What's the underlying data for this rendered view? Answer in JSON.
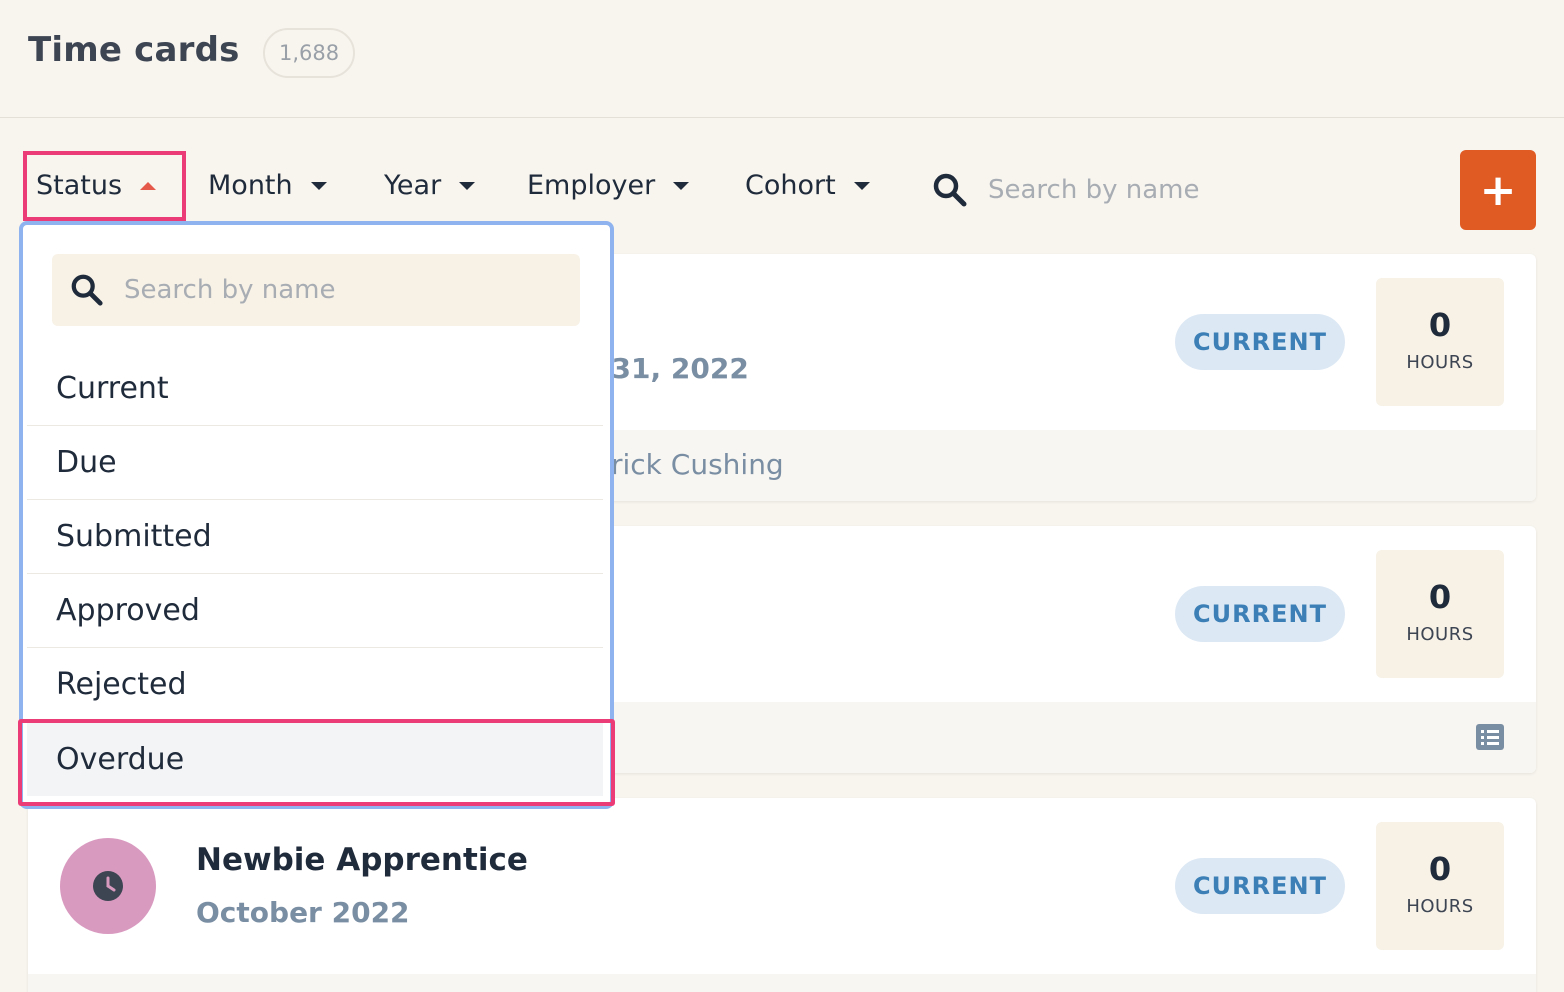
{
  "header": {
    "title": "Time cards",
    "count": "1,688"
  },
  "filters": {
    "status": "Status",
    "month": "Month",
    "year": "Year",
    "employer": "Employer",
    "cohort": "Cohort",
    "search_placeholder": "Search by name",
    "add_label": "+"
  },
  "dropdown": {
    "search_placeholder": "Search by name",
    "options": [
      "Current",
      "Due",
      "Submitted",
      "Approved",
      "Rejected",
      "Overdue"
    ]
  },
  "cards": [
    {
      "date": "r 31, 2022",
      "footer": "trick Cushing",
      "status": "CURRENT",
      "hours": "0",
      "hours_label": "HOURS"
    },
    {
      "status": "CURRENT",
      "hours": "0",
      "hours_label": "HOURS"
    },
    {
      "name": "Newbie Apprentice",
      "date": "October 2022",
      "status": "CURRENT",
      "hours": "0",
      "hours_label": "HOURS"
    }
  ],
  "colors": {
    "accent": "#e05a24",
    "highlight": "#ec3c78",
    "dropdown_border": "#8fb3ee",
    "status_text": "#3b7fb6",
    "avatar": "#d99ac0"
  },
  "icons": [
    "search-icon",
    "plus-icon",
    "caret-down-icon",
    "caret-up-icon",
    "clock-icon",
    "list-icon"
  ]
}
